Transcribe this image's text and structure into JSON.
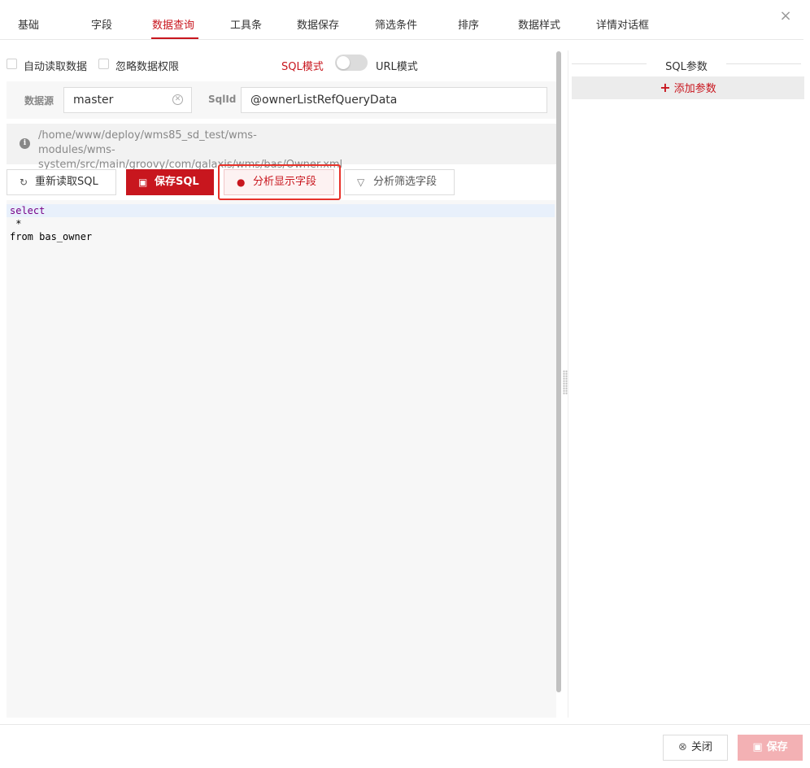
{
  "tabs": [
    {
      "label": "基础"
    },
    {
      "label": "字段"
    },
    {
      "label": "数据查询"
    },
    {
      "label": "工具条"
    },
    {
      "label": "数据保存"
    },
    {
      "label": "筛选条件"
    },
    {
      "label": "排序"
    },
    {
      "label": "数据样式"
    },
    {
      "label": "详情对话框"
    }
  ],
  "active_tab": "数据查询",
  "close_icon": "×",
  "options": {
    "auto_read_label": "自动读取数据",
    "ignore_permission_label": "忽略数据权限",
    "sql_mode_label": "SQL模式",
    "url_mode_label": "URL模式",
    "mode_is_url": false
  },
  "datasource": {
    "label": "数据源",
    "value": "master",
    "sqlid_label": "SqlId",
    "sqlid_value": "@ownerListRefQueryData"
  },
  "path_info": {
    "text": "/home/www/deploy/wms85_sd_test/wms-modules/wms-system/src/main/groovy/com/galaxis/wms/bas/Owner.xml"
  },
  "buttons": {
    "reload_sql": "重新读取SQL",
    "save_sql": "保存SQL",
    "analyze_display": "分析显示字段",
    "analyze_filter": "分析筛选字段"
  },
  "editor": {
    "lines": [
      "select",
      " *",
      "from bas_owner"
    ]
  },
  "right_panel": {
    "title": "SQL参数",
    "add_param": "添加参数"
  },
  "footer": {
    "close_label": "关闭",
    "save_label": "保存"
  },
  "colors": {
    "accent": "#c8161e",
    "highlight_frame": "#e8322a",
    "save_disabled": "#f3b1b4"
  }
}
